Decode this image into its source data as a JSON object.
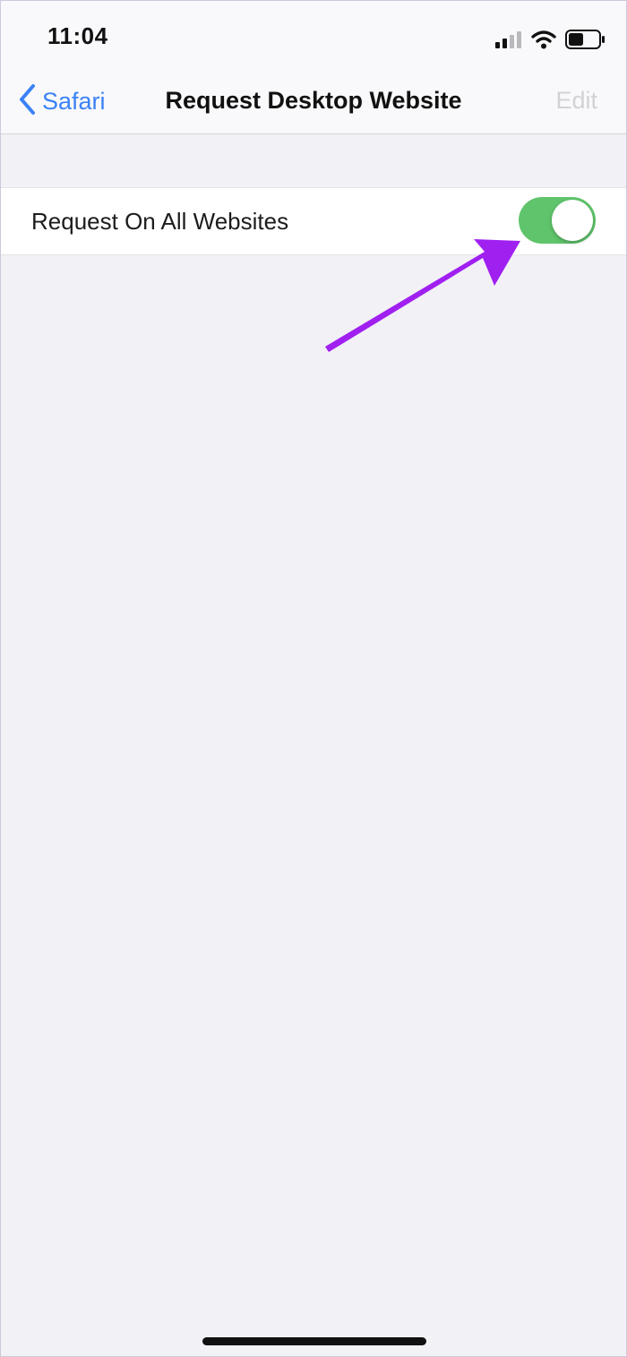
{
  "status_bar": {
    "time": "11:04",
    "icons": [
      "cellular-signal-icon",
      "wifi-icon",
      "battery-icon"
    ]
  },
  "nav_bar": {
    "back_label": "Safari",
    "title": "Request Desktop Website",
    "edit_label": "Edit"
  },
  "settings": {
    "items": [
      {
        "label": "Request On All Websites",
        "toggle_on": true
      }
    ]
  },
  "colors": {
    "accent_blue": "#3a82f6",
    "toggle_on_green": "#5fc46b",
    "annotation_purple": "#a020f0",
    "disabled_gray": "#d2d2d6",
    "background": "#f2f1f6"
  }
}
